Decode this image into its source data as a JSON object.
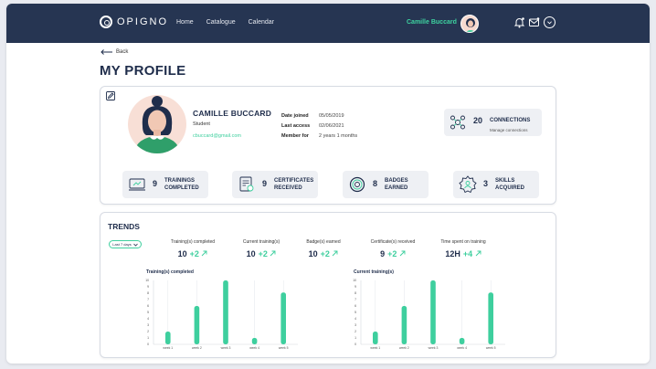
{
  "header": {
    "logo_text": "OPIGNO",
    "nav": [
      "Home",
      "Catalogue",
      "Calendar"
    ],
    "user_name": "Camille Buccard"
  },
  "back_label": "Back",
  "page_title": "MY PROFILE",
  "profile": {
    "name": "CAMILLE BUCCARD",
    "role": "Student",
    "email": "cbuccard@gmail.com",
    "meta": [
      {
        "label": "Date joined",
        "value": "05/05/2019"
      },
      {
        "label": "Last access",
        "value": "02/06/2021"
      },
      {
        "label": "Member for",
        "value": "2 years 1 months"
      }
    ],
    "connections": {
      "count": "20",
      "label": "CONNECTIONS",
      "link": "Manage connections",
      "icon": "connections-icon"
    }
  },
  "stats": [
    {
      "count": "9",
      "label": "TRAININGS COMPLETED",
      "icon": "monitor-icon"
    },
    {
      "count": "9",
      "label": "CERTIFICATES RECEIVED",
      "icon": "certificate-icon"
    },
    {
      "count": "8",
      "label": "BADGES EARNED",
      "icon": "badge-icon"
    },
    {
      "count": "3",
      "label": "SKILLS ACQUIRED",
      "icon": "skills-icon"
    }
  ],
  "trends": {
    "title": "TRENDS",
    "range_selected": "Last 7 days",
    "metrics": [
      {
        "label": "Training(s) completed",
        "value": "10",
        "delta": "+2"
      },
      {
        "label": "Current training(s)",
        "value": "10",
        "delta": "+2"
      },
      {
        "label": "Badge(s) earned",
        "value": "10",
        "delta": "+2"
      },
      {
        "label": "Certificate(s) received",
        "value": "9",
        "delta": "+2"
      },
      {
        "label": "Time spent on training",
        "value": "12H",
        "delta": "+4"
      }
    ]
  },
  "colors": {
    "navy": "#263552",
    "accent": "#3ecf9e",
    "ink": "#1f2d4b"
  },
  "chart_data": [
    {
      "type": "bar",
      "title": "Training(s) completed",
      "categories": [
        "week 1",
        "week 2",
        "week 3",
        "week 4",
        "week 5"
      ],
      "values": [
        2,
        6,
        10,
        1,
        8.1
      ],
      "ylim": [
        0,
        10
      ],
      "yticks": [
        "0",
        "1",
        "2",
        "3",
        "4",
        "5",
        "6",
        "7",
        "8",
        "9",
        "10"
      ]
    },
    {
      "type": "bar",
      "title": "Current training(s)",
      "categories": [
        "week 1",
        "week 2",
        "week 3",
        "week 4",
        "week 5"
      ],
      "values": [
        2,
        6,
        10,
        1,
        8.1
      ],
      "ylim": [
        0,
        10
      ],
      "yticks": [
        "0",
        "1",
        "2",
        "3",
        "4",
        "5",
        "6",
        "7",
        "8",
        "9",
        "10"
      ]
    }
  ]
}
